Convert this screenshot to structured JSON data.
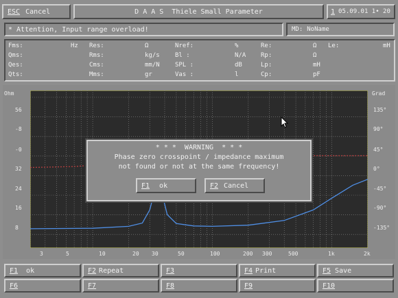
{
  "titlebar": {
    "esc_key": "ESC",
    "cancel_label": "Cancel",
    "title": "D A A S  Thiele Small Parameter",
    "date_key": "1",
    "date_time": "05.09.01 1• 20"
  },
  "status": {
    "message": "* Attention, Input range overload!",
    "md_label": "MD:",
    "md_value": "NoName"
  },
  "params": [
    {
      "label": "Fms:",
      "unit": "Hz"
    },
    {
      "label": "Res:",
      "unit": "Ω"
    },
    {
      "label": "Nref:",
      "unit": "%"
    },
    {
      "label": "Re:",
      "unit": "Ω"
    },
    {
      "label": "Le:",
      "unit": "mH"
    },
    {
      "label": "Qms:",
      "unit": ""
    },
    {
      "label": "Rms:",
      "unit": "kg/s"
    },
    {
      "label": "Bl :",
      "unit": "N/A"
    },
    {
      "label": "Rp:",
      "unit": "Ω"
    },
    {
      "label": "Qes:",
      "unit": ""
    },
    {
      "label": "Cms:",
      "unit": "mm/N"
    },
    {
      "label": "SPL :",
      "unit": "dB"
    },
    {
      "label": "Lp:",
      "unit": "mH"
    },
    {
      "label": "Qts:",
      "unit": ""
    },
    {
      "label": "Mms:",
      "unit": "gr"
    },
    {
      "label": "Vas :",
      "unit": "l"
    },
    {
      "label": "Cp:",
      "unit": "pF"
    }
  ],
  "chart_data": {
    "type": "line",
    "y_left_unit": "Ohm",
    "y_left_ticks": [
      "56",
      "-8",
      "-0",
      "32",
      "24",
      "16",
      "8"
    ],
    "y_right_unit": "Grad",
    "y_right_ticks": [
      "135°",
      "90°",
      "45°",
      "0°",
      "-45°",
      "-90°",
      "-135°"
    ],
    "x_ticks": [
      "3",
      "5",
      "10",
      "20",
      "30",
      "50",
      "100",
      "200",
      "300",
      "500",
      "1k",
      "2k"
    ],
    "x_scale": "log",
    "xlim": [
      3,
      2000
    ],
    "grid": true,
    "series": [
      {
        "color": "#4f8fe6",
        "points": [
          [
            3,
            6
          ],
          [
            10,
            6.2
          ],
          [
            20,
            7
          ],
          [
            26,
            8.4
          ],
          [
            30,
            14
          ],
          [
            33,
            22
          ],
          [
            35,
            28
          ],
          [
            38,
            21
          ],
          [
            42,
            12
          ],
          [
            50,
            8.2
          ],
          [
            70,
            7.2
          ],
          [
            100,
            7
          ],
          [
            200,
            7.5
          ],
          [
            400,
            9.5
          ],
          [
            700,
            14
          ],
          [
            1000,
            19
          ],
          [
            1500,
            24.5
          ],
          [
            2000,
            27
          ]
        ]
      },
      {
        "color": "#b34040",
        "points": [
          [
            3,
            32
          ],
          [
            7,
            32.4
          ],
          [
            10,
            33
          ],
          [
            15,
            35
          ],
          [
            20,
            37
          ],
          [
            30,
            37.5
          ],
          [
            40,
            36
          ],
          [
            60,
            36
          ],
          [
            100,
            37
          ],
          [
            200,
            37.5
          ],
          [
            500,
            37
          ],
          [
            1000,
            37
          ],
          [
            2000,
            37
          ]
        ]
      }
    ]
  },
  "dialog": {
    "title": "* * *  WARNING  * * *",
    "line1": "Phase zero crosspoint / impedance maximum",
    "line2": "not found or not at the same frequency!",
    "ok_key": "F1",
    "ok_label": "ok",
    "cancel_key": "F2",
    "cancel_label": "Cancel"
  },
  "fkeys": [
    {
      "key": "F1",
      "label": "ok"
    },
    {
      "key": "F2",
      "label": "Repeat"
    },
    {
      "key": "F3",
      "label": ""
    },
    {
      "key": "F4",
      "label": "Print"
    },
    {
      "key": "F5",
      "label": "Save"
    },
    {
      "key": "F6",
      "label": ""
    },
    {
      "key": "F7",
      "label": ""
    },
    {
      "key": "F8",
      "label": ""
    },
    {
      "key": "F9",
      "label": ""
    },
    {
      "key": "F10",
      "label": ""
    }
  ]
}
